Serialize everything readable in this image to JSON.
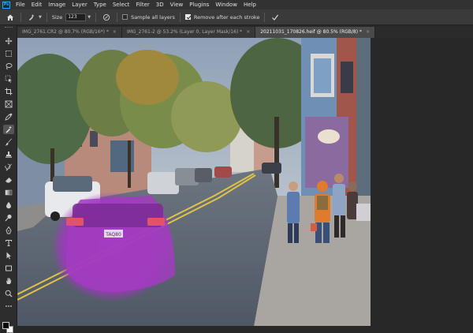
{
  "app": {
    "logo_text": "Ps"
  },
  "menu": [
    "File",
    "Edit",
    "Image",
    "Layer",
    "Type",
    "Select",
    "Filter",
    "3D",
    "View",
    "Plugins",
    "Window",
    "Help"
  ],
  "options": {
    "size_label": "Size",
    "size_value": "123",
    "sample_all_layers_label": "Sample all layers",
    "sample_all_layers_checked": false,
    "remove_after_stroke_label": "Remove after each stroke",
    "remove_after_stroke_checked": true
  },
  "tabs": [
    {
      "label": "IMG_2761.CR2 @ 80.7% (RGB/16*) *",
      "active": false
    },
    {
      "label": "IMG_2761-2 @ 53.2% (Layer 0, Layer Mask/16) *",
      "active": false
    },
    {
      "label": "20211031_170826.heif @ 80.5% (RGB/8) *",
      "active": true
    }
  ],
  "tools": [
    "move-tool",
    "artboard-tool",
    "lasso-tool",
    "object-selection-tool",
    "crop-tool",
    "frame-tool",
    "eyedropper-tool",
    "remove-tool",
    "brush-tool",
    "clone-stamp-tool",
    "history-brush-tool",
    "eraser-tool",
    "gradient-tool",
    "blur-tool",
    "dodge-tool",
    "pen-tool",
    "type-tool",
    "path-selection-tool",
    "rectangle-tool",
    "hand-tool",
    "zoom-tool",
    "more-tools"
  ],
  "active_tool": "remove-tool",
  "colors": {
    "foreground": "#000000",
    "background": "#ffffff",
    "brush_overlay": "#b23bd1"
  },
  "photo": {
    "plate_text": "TAQ80"
  }
}
